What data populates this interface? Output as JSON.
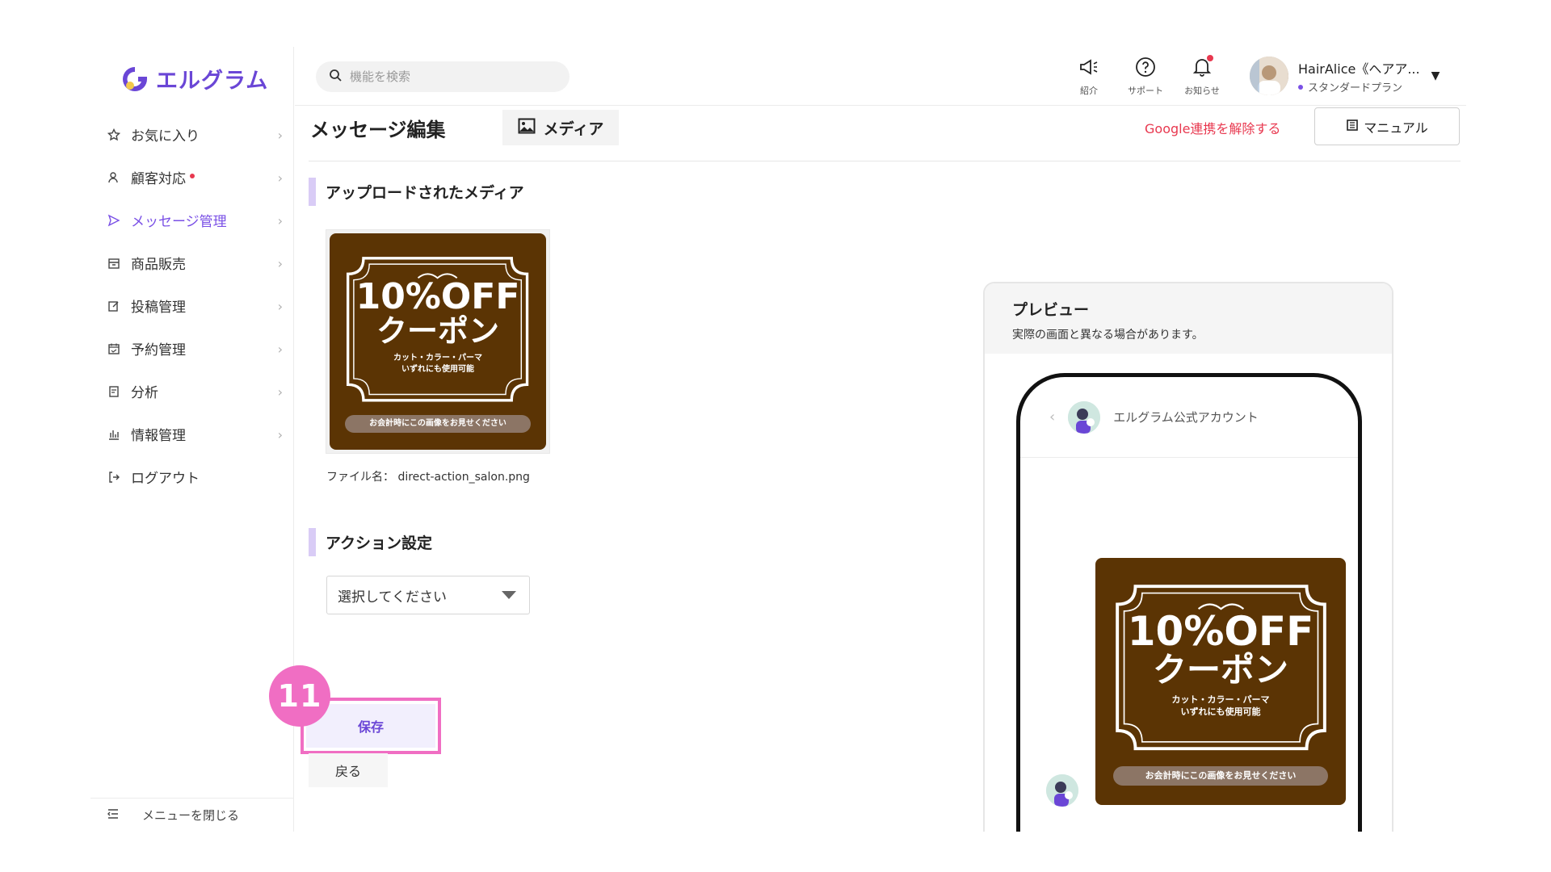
{
  "app": {
    "logo_text": "エルグラム",
    "brand_color": "#6a46d6",
    "accent_pink": "#f06ec3"
  },
  "sidebar": {
    "items": [
      {
        "label": "お気に入り",
        "icon": "star-icon",
        "active": false,
        "dot": false
      },
      {
        "label": "顧客対応",
        "icon": "user-icon",
        "active": false,
        "dot": true
      },
      {
        "label": "メッセージ管理",
        "icon": "send-icon",
        "active": true,
        "dot": false
      },
      {
        "label": "商品販売",
        "icon": "shop-icon",
        "active": false,
        "dot": false
      },
      {
        "label": "投稿管理",
        "icon": "edit-icon",
        "active": false,
        "dot": false
      },
      {
        "label": "予約管理",
        "icon": "calendar-icon",
        "active": false,
        "dot": false
      },
      {
        "label": "分析",
        "icon": "report-icon",
        "active": false,
        "dot": false
      },
      {
        "label": "情報管理",
        "icon": "bar-chart-icon",
        "active": false,
        "dot": false
      }
    ],
    "logout": "ログアウト",
    "close_menu": "メニューを閉じる"
  },
  "header": {
    "search_placeholder": "機能を検索",
    "intro_label": "紹介",
    "support_label": "サポート",
    "notice_label": "お知らせ",
    "user_name": "HairAlice《ヘアア...",
    "user_plan": "スタンダードプラン"
  },
  "page": {
    "title": "メッセージ編集",
    "media_tab": "メディア",
    "google_link": "Google連携を解除する",
    "manual_button": "マニュアル"
  },
  "media": {
    "section_title": "アップロードされたメディア",
    "file_name_label": "ファイル名：",
    "file_name": "direct-action_salon.png"
  },
  "coupon": {
    "line1": "10%OFF",
    "line2": "クーポン",
    "sub1": "カット・カラー・パーマ",
    "sub2": "いずれにも使用可能",
    "pill": "お会計時にこの画像をお見せください"
  },
  "action": {
    "section_title": "アクション設定",
    "select_value": "選択してください"
  },
  "buttons": {
    "save": "保存",
    "back": "戻る",
    "step_badge": "11"
  },
  "preview": {
    "title": "プレビュー",
    "note": "実際の画面と異なる場合があります。",
    "account_name": "エルグラム公式アカウント"
  }
}
